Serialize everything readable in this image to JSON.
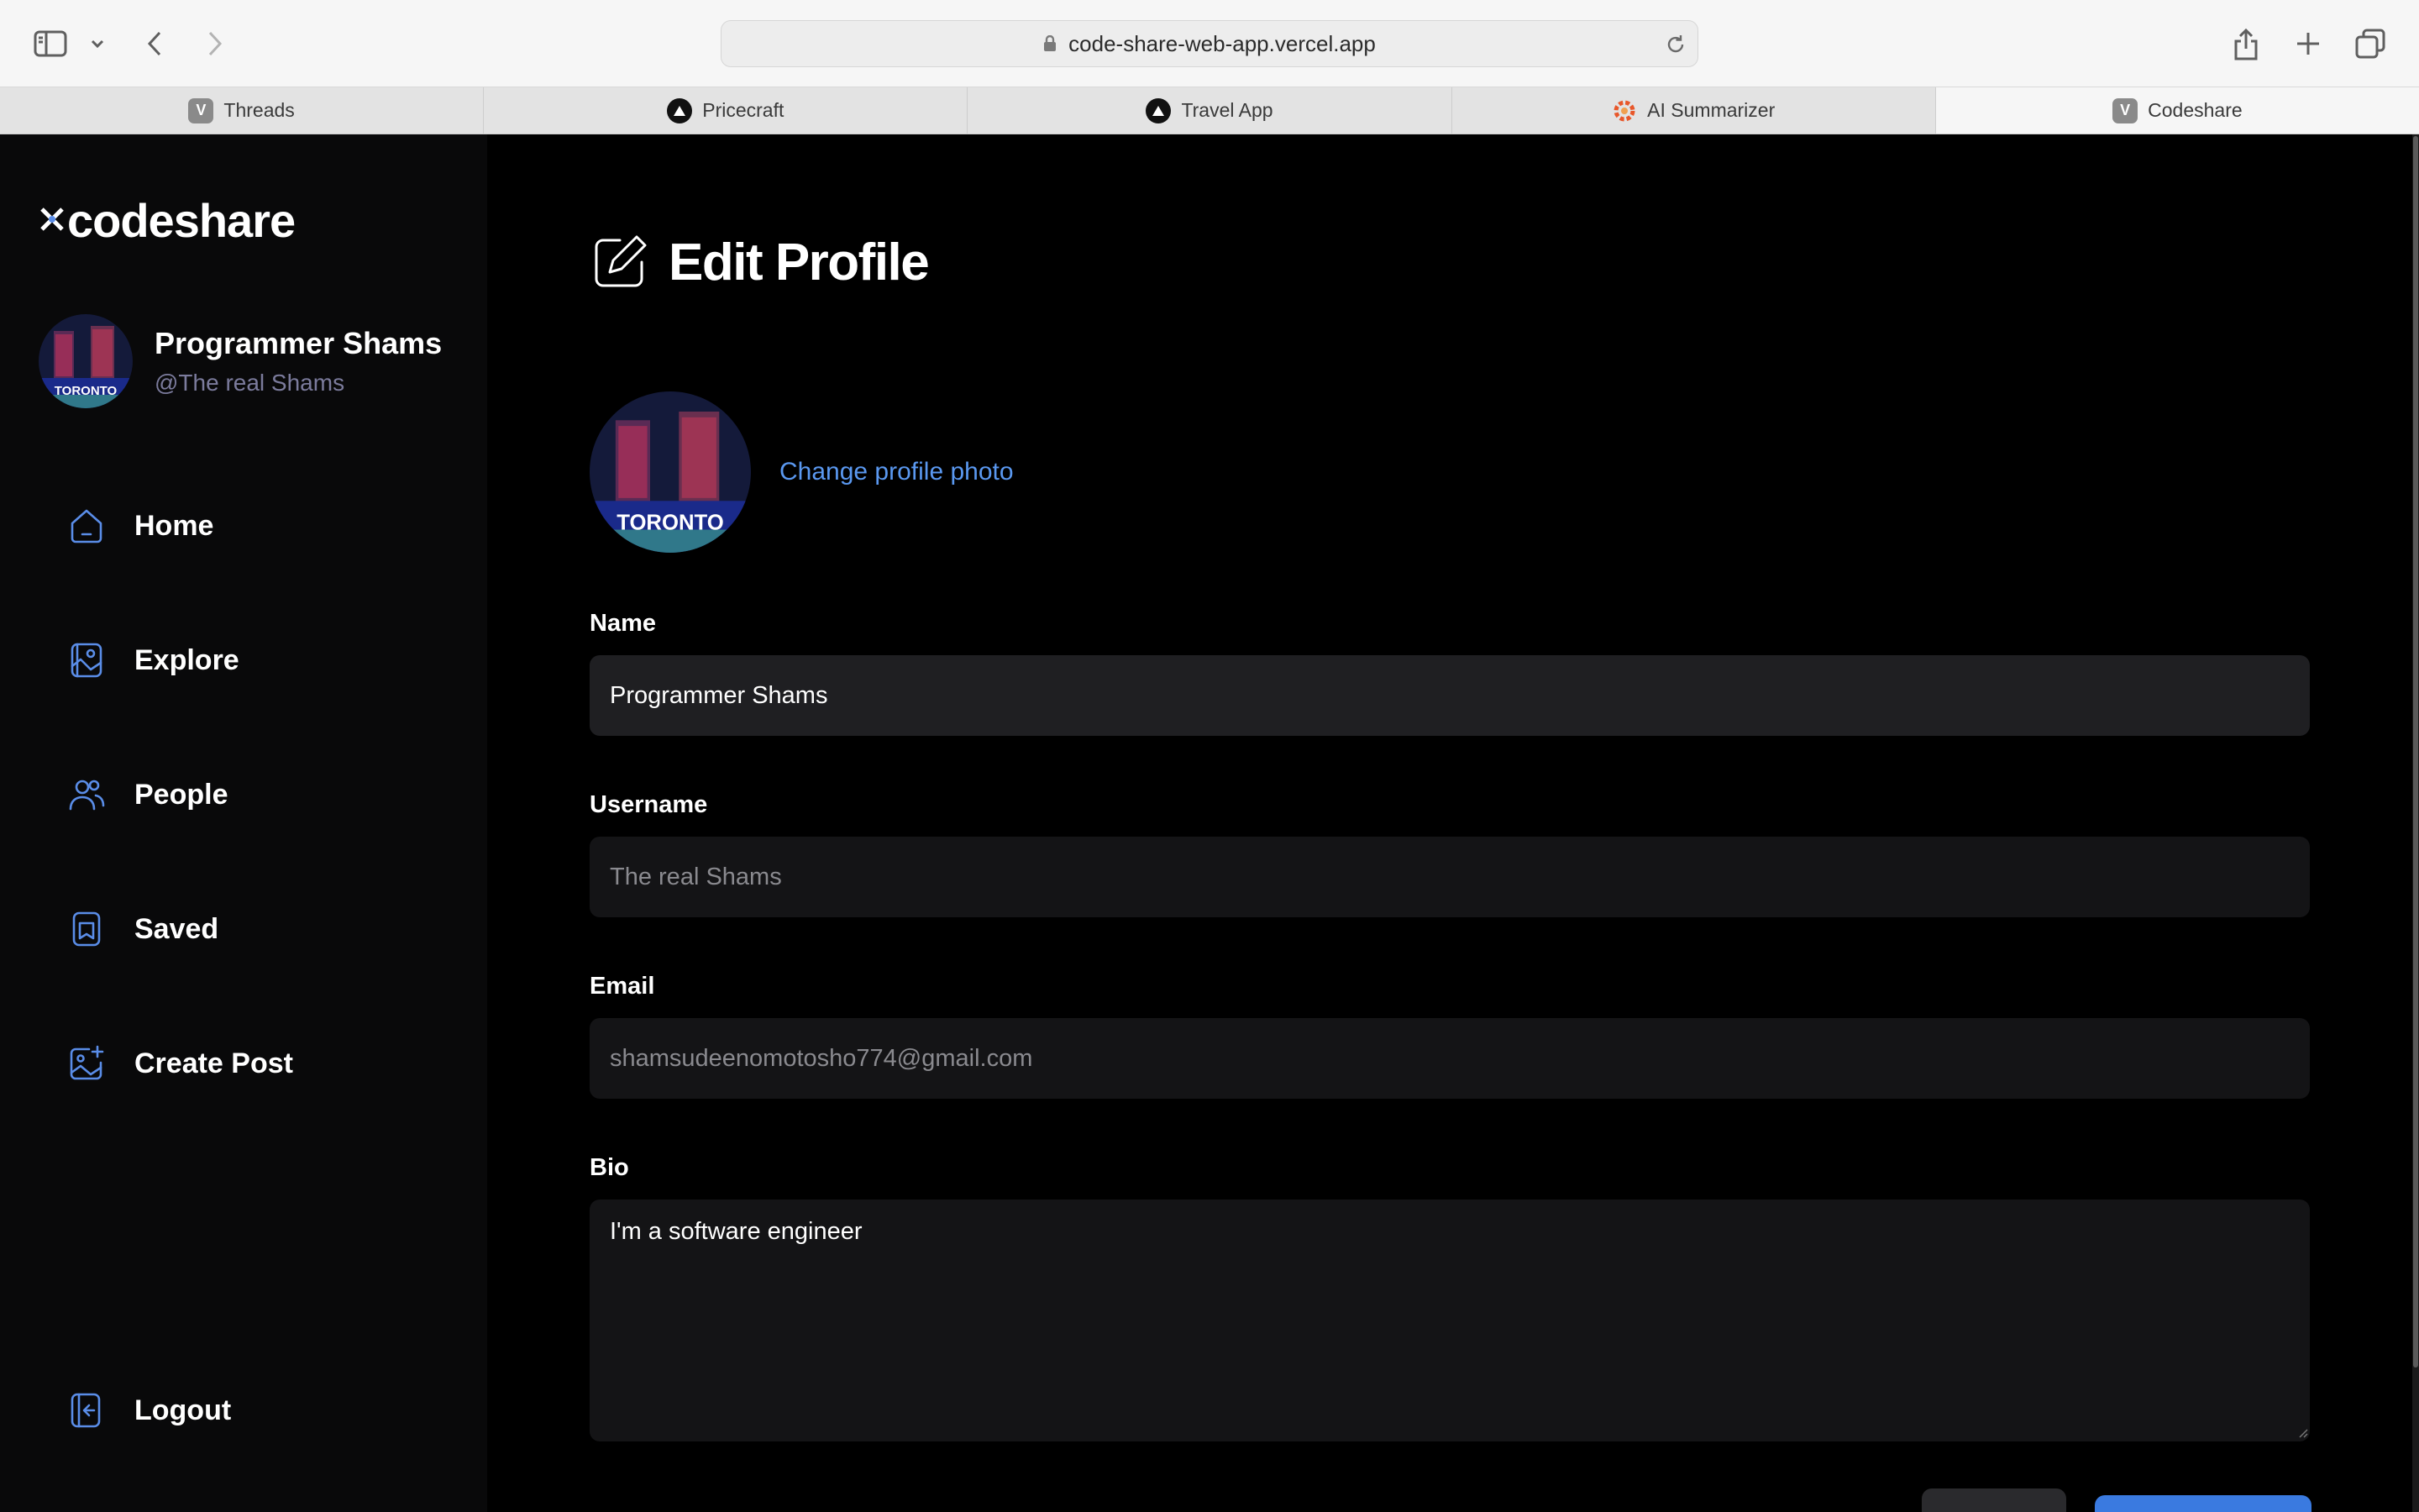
{
  "browser": {
    "url": "code-share-web-app.vercel.app",
    "tabs": [
      {
        "label": "Threads",
        "favicon": "V"
      },
      {
        "label": "Pricecraft",
        "favicon": "triangle-icon"
      },
      {
        "label": "Travel App",
        "favicon": "triangle-icon"
      },
      {
        "label": "AI Summarizer",
        "favicon": "gear-icon"
      },
      {
        "label": "Codeshare",
        "favicon": "V"
      }
    ],
    "active_tab": "Codeshare"
  },
  "sidebar": {
    "logo": "codeshare",
    "profile": {
      "name": "Programmer Shams",
      "handle": "@The real Shams",
      "avatar_text": "TORONTO"
    },
    "nav": [
      {
        "label": "Home",
        "icon": "home-icon"
      },
      {
        "label": "Explore",
        "icon": "gallery-icon"
      },
      {
        "label": "People",
        "icon": "people-icon"
      },
      {
        "label": "Saved",
        "icon": "bookmark-icon"
      },
      {
        "label": "Create Post",
        "icon": "image-add-icon"
      }
    ],
    "logout": {
      "label": "Logout",
      "icon": "logout-icon"
    }
  },
  "main": {
    "title": "Edit Profile",
    "photo": {
      "change_label": "Change profile photo",
      "avatar_text": "TORONTO"
    },
    "fields": {
      "name": {
        "label": "Name",
        "value": "Programmer Shams"
      },
      "username": {
        "label": "Username",
        "value": "The real Shams"
      },
      "email": {
        "label": "Email",
        "value": "shamsudeenomotosho774@gmail.com"
      },
      "bio": {
        "label": "Bio",
        "value": "I'm a software engineer"
      }
    }
  },
  "colors": {
    "accent": "#5a8de8",
    "link": "#5a98f0",
    "sidebar_bg": "#09090a",
    "main_bg": "#000000",
    "input_bg": "#1f1f22"
  }
}
